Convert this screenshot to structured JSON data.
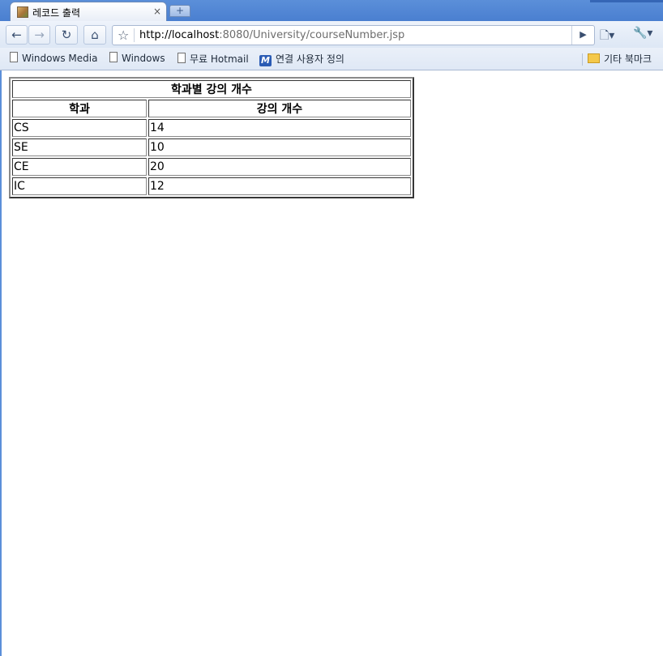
{
  "browser": {
    "tab": {
      "title": "레코드 출력",
      "close": "×"
    },
    "new_tab": "+",
    "url": {
      "scheme_host": "http://localhost",
      "rest": ":8080/University/courseNumber.jsp"
    },
    "bookmarks": [
      {
        "label": "Windows Media",
        "icon": "page-icon"
      },
      {
        "label": "Windows",
        "icon": "page-icon"
      },
      {
        "label": "무료 Hotmail",
        "icon": "page-icon"
      },
      {
        "label": "연결 사용자 정의",
        "icon": "msn-m-icon"
      }
    ],
    "other_bookmarks": "기타 북마크"
  },
  "page": {
    "table": {
      "caption": "학과별 강의 개수",
      "headers": [
        "학과",
        "강의 개수"
      ],
      "rows": [
        [
          "CS",
          "14"
        ],
        [
          "SE",
          "10"
        ],
        [
          "CE",
          "20"
        ],
        [
          "IC",
          "12"
        ]
      ]
    }
  }
}
